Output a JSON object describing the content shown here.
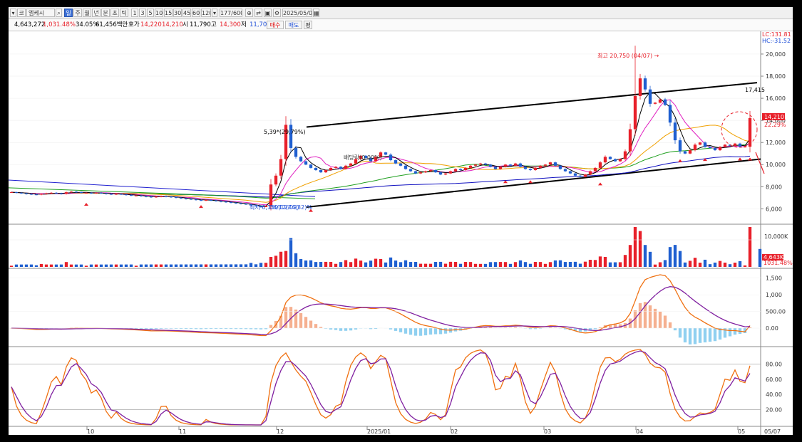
{
  "toolbar": {
    "code": "코",
    "name": "엠케시",
    "period_tabs": [
      "일",
      "주",
      "월",
      "년",
      "분",
      "초",
      "틱"
    ],
    "interval_tabs": [
      "1",
      "3",
      "5",
      "10",
      "15",
      "30",
      "45",
      "60",
      "120"
    ],
    "count": "177/600",
    "date": "2025/05/07"
  },
  "quote": {
    "volume": "4,643,272",
    "volume_pct": "1,031.48%",
    "turnover_pct": "34.05%",
    "amount": "61,456백만",
    "ask_label": "호가",
    "ask": "14,220",
    "price": "14,210",
    "open_label": "시",
    "open": "11,790",
    "high_label": "고",
    "high": "14,300",
    "low_label": "저",
    "low": "11,700",
    "buy_label": "매수",
    "sell_label": "매도",
    "pyeong": "평"
  },
  "colors": {
    "up": "#e8202a",
    "down": "#1f5fd0",
    "ma5": "#000000",
    "ma10": "#e020c0",
    "ma20": "#f0a000",
    "ma60": "#20a020",
    "ma120": "#1010c0",
    "macd": "#f07010",
    "signal": "#8020a0",
    "osc_up": "#f5b090",
    "osc_down": "#90d0f0"
  },
  "chart_data": [
    {
      "type": "candlestick",
      "title": "",
      "ylim": [
        4800,
        21800
      ],
      "y_ticks": [
        "20,000",
        "18,000",
        "16,000",
        "14,000",
        "12,000",
        "10,000",
        "8,000",
        "6,000"
      ],
      "right_labels": {
        "lc": "LC:131.81",
        "hc": "HC:-31.52",
        "price": "14,210",
        "pct": "22.29%"
      },
      "annotations": {
        "high": "최고 20,750 (04/07) →",
        "low": "최저 6,150(12/09)",
        "low_extra": "06/12/74(32)%",
        "div": "배당락(0.00%)",
        "trend_pct": "5,39*(29,79%)",
        "trend_end": "17,415"
      },
      "x_labels": [
        "10",
        "11",
        "12",
        "2025/01",
        "02",
        "03",
        "04",
        "05"
      ],
      "last_date": "05/07",
      "closes": [
        7500,
        7450,
        7400,
        7350,
        7300,
        7280,
        7350,
        7400,
        7450,
        7400,
        7350,
        7500,
        7550,
        7500,
        7450,
        7450,
        7400,
        7450,
        7400,
        7350,
        7300,
        7350,
        7300,
        7250,
        7200,
        7200,
        7150,
        7100,
        7050,
        7100,
        7150,
        7100,
        7050,
        7000,
        6950,
        6900,
        6850,
        6800,
        6750,
        6800,
        6750,
        6700,
        6650,
        6600,
        6550,
        6500,
        6450,
        6400,
        6300,
        6250,
        6150,
        6250,
        8200,
        9000,
        10500,
        13600,
        11500,
        10700,
        10300,
        10000,
        9700,
        9500,
        9300,
        9500,
        9700,
        9800,
        9600,
        9900,
        10100,
        10500,
        10800,
        10600,
        10300,
        10700,
        11100,
        10900,
        10400,
        10100,
        9900,
        9600,
        9400,
        9200,
        9300,
        9400,
        9500,
        9300,
        9100,
        9200,
        9400,
        9600,
        9500,
        9700,
        9900,
        10000,
        10100,
        10000,
        9800,
        9600,
        9800,
        10000,
        9900,
        10100,
        9800,
        9600,
        9500,
        9700,
        9900,
        10000,
        10200,
        9900,
        9600,
        9400,
        9200,
        9000,
        8900,
        9100,
        9400,
        9700,
        10200,
        10700,
        10500,
        10300,
        10500,
        11200,
        13200,
        16200,
        17800,
        16800,
        15500,
        15600,
        15900,
        15400,
        13800,
        12200,
        11200,
        11000,
        11300,
        11800,
        12000,
        11600,
        11500,
        11300,
        11600,
        11800,
        11700,
        11900,
        11600,
        11620,
        14210
      ],
      "volume_max_label": "10,000K",
      "volume_labels": {
        "vol": "4,643K",
        "pct": "1031.48%"
      },
      "macd_ticks": [
        "1,500",
        "1,000",
        "500.00",
        "0.00"
      ],
      "stoch_ticks": [
        "80.00",
        "60.00",
        "40.00",
        "20.00"
      ]
    }
  ]
}
